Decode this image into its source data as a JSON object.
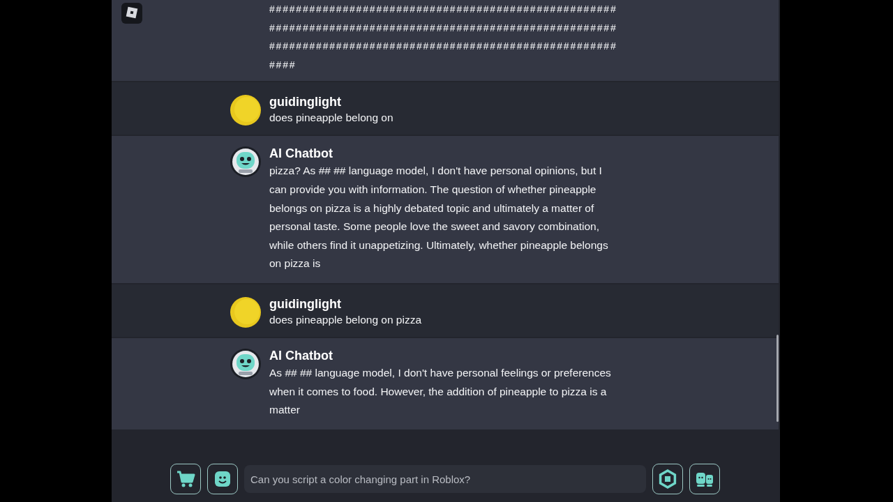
{
  "messages": [
    {
      "kind": "continued",
      "lines": [
        "####################################################",
        "####################################################",
        "####################################################",
        "####"
      ]
    },
    {
      "kind": "user",
      "author": "guidinglight",
      "text": "does pineapple belong on"
    },
    {
      "kind": "bot",
      "author": "AI Chatbot",
      "text": "pizza? As ## ## language model, I don't have personal opinions, but I can provide you with information. The question of whether pineapple belongs on pizza is a highly debated topic and ultimately a matter of personal taste. Some people love the sweet and savory combination, while others find it unappetizing. Ultimately, whether pineapple belongs on pizza is"
    },
    {
      "kind": "user",
      "author": "guidinglight",
      "text": "does pineapple belong on pizza"
    },
    {
      "kind": "bot",
      "author": "AI Chatbot",
      "text": "As ## ## language model, I don't have personal feelings or preferences when it comes to food. However, the addition of pineapple to pizza is a matter"
    }
  ],
  "input": {
    "placeholder": "Can you script a color changing part in Roblox?"
  }
}
